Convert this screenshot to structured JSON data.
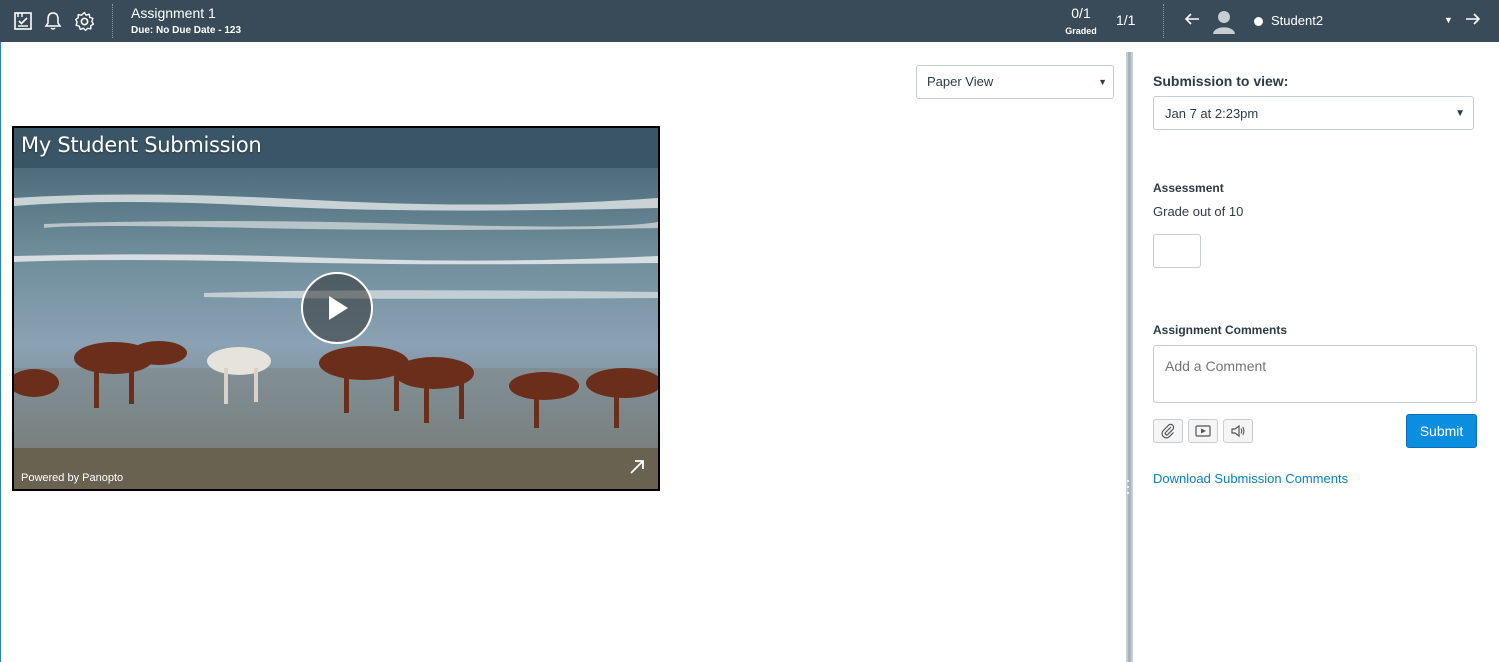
{
  "header": {
    "assignment_title": "Assignment 1",
    "due_text": "Due: No Due Date - 123",
    "graded_count": "0/1",
    "graded_label": "Graded",
    "page_count": "1/1",
    "student_name": "Student2",
    "icons": [
      "gradebook-icon",
      "bell-icon",
      "gear-icon"
    ]
  },
  "main": {
    "view_select": "Paper View",
    "video": {
      "title": "My Student Submission",
      "powered_by": "Powered by Panopto"
    }
  },
  "sidebar": {
    "submission_label": "Submission to view:",
    "submission_value": "Jan 7 at 2:23pm",
    "assessment_label": "Assessment",
    "grade_out_of": "Grade out of 10",
    "comments_label": "Assignment Comments",
    "comment_placeholder": "Add a Comment",
    "submit_label": "Submit",
    "download_link": "Download Submission Comments"
  },
  "colors": {
    "topbar": "#394b58",
    "accent": "#0b8ee0",
    "link": "#0a7fc4"
  }
}
